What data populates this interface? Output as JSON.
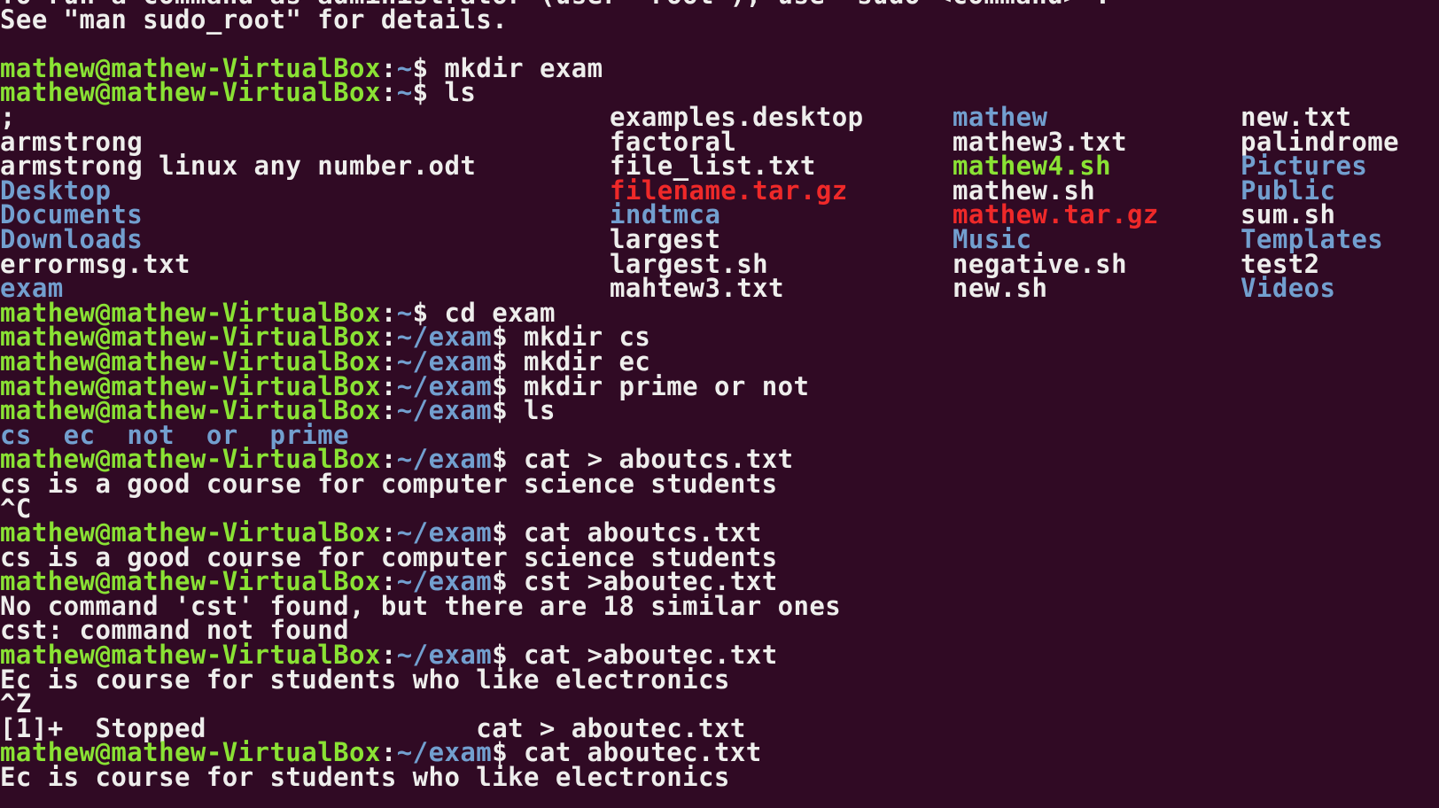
{
  "terminal": {
    "header_lines": [
      "To run a command as administrator (user \"root\"), use \"sudo <command>\".",
      "See \"man sudo_root\" for details."
    ],
    "prompt_user_host": "mathew@mathew-VirtualBox",
    "prompt_sep": ":",
    "prompt_dollar": "$ ",
    "home_path": "~",
    "exam_path": "~/exam",
    "commands": {
      "mkdir_exam": "mkdir exam",
      "ls_home": "ls",
      "cd_exam": "cd exam",
      "mkdir_cs": "mkdir cs",
      "mkdir_ec": "mkdir ec",
      "mkdir_prime": "mkdir prime or not",
      "ls_exam": "ls",
      "cat_write_cs": "cat > aboutcs.txt",
      "cat_read_cs": "cat aboutcs.txt",
      "cst_typo": "cst >aboutec.txt",
      "cat_write_ec": "cat >aboutec.txt",
      "cat_read_ec": "cat aboutec.txt"
    },
    "ls_home_columns": [
      [
        {
          "name": ";",
          "type": "file"
        },
        {
          "name": "armstrong",
          "type": "file"
        },
        {
          "name": "armstrong linux any number.odt",
          "type": "file"
        },
        {
          "name": "Desktop",
          "type": "dir"
        },
        {
          "name": "Documents",
          "type": "dir"
        },
        {
          "name": "Downloads",
          "type": "dir"
        },
        {
          "name": "errormsg.txt",
          "type": "file"
        },
        {
          "name": "exam",
          "type": "dir"
        }
      ],
      [
        {
          "name": "examples.desktop",
          "type": "file"
        },
        {
          "name": "factoral",
          "type": "file"
        },
        {
          "name": "file_list.txt",
          "type": "file"
        },
        {
          "name": "filename.tar.gz",
          "type": "archive"
        },
        {
          "name": "indtmca",
          "type": "dir"
        },
        {
          "name": "largest",
          "type": "file"
        },
        {
          "name": "largest.sh",
          "type": "file"
        },
        {
          "name": "mahtew3.txt",
          "type": "file"
        }
      ],
      [
        {
          "name": "mathew",
          "type": "dir"
        },
        {
          "name": "mathew3.txt",
          "type": "file"
        },
        {
          "name": "mathew4.sh",
          "type": "exec"
        },
        {
          "name": "mathew.sh",
          "type": "file"
        },
        {
          "name": "mathew.tar.gz",
          "type": "archive"
        },
        {
          "name": "Music",
          "type": "dir"
        },
        {
          "name": "negative.sh",
          "type": "file"
        },
        {
          "name": "new.sh",
          "type": "file"
        }
      ],
      [
        {
          "name": "new.txt",
          "type": "file"
        },
        {
          "name": "palindrome",
          "type": "file"
        },
        {
          "name": "Pictures",
          "type": "dir"
        },
        {
          "name": "Public",
          "type": "dir"
        },
        {
          "name": "sum.sh",
          "type": "file"
        },
        {
          "name": "Templates",
          "type": "dir"
        },
        {
          "name": "test2",
          "type": "file"
        },
        {
          "name": "Videos",
          "type": "dir"
        }
      ]
    ],
    "ls_exam_items": [
      "cs",
      "ec",
      "not",
      "or",
      "prime"
    ],
    "outputs": {
      "cs_input": "cs is a good course for computer science students",
      "ctrl_c": "^C",
      "cs_cat": "cs is a good course for computer science students",
      "cst_err1": "No command 'cst' found, but there are 18 similar ones",
      "cst_err2": "cst: command not found",
      "ec_input": "Ec is course for students who like electronics",
      "ctrl_z": "^Z",
      "job_stopped": "[1]+  Stopped                 cat > aboutec.txt",
      "ec_cat": "Ec is course for students who like electronics"
    },
    "colors": {
      "background": "#300a24",
      "text": "#eeeeec",
      "prompt_user": "#8ae234",
      "directory": "#729fcf",
      "executable": "#8ae234",
      "archive": "#ef2929"
    }
  }
}
